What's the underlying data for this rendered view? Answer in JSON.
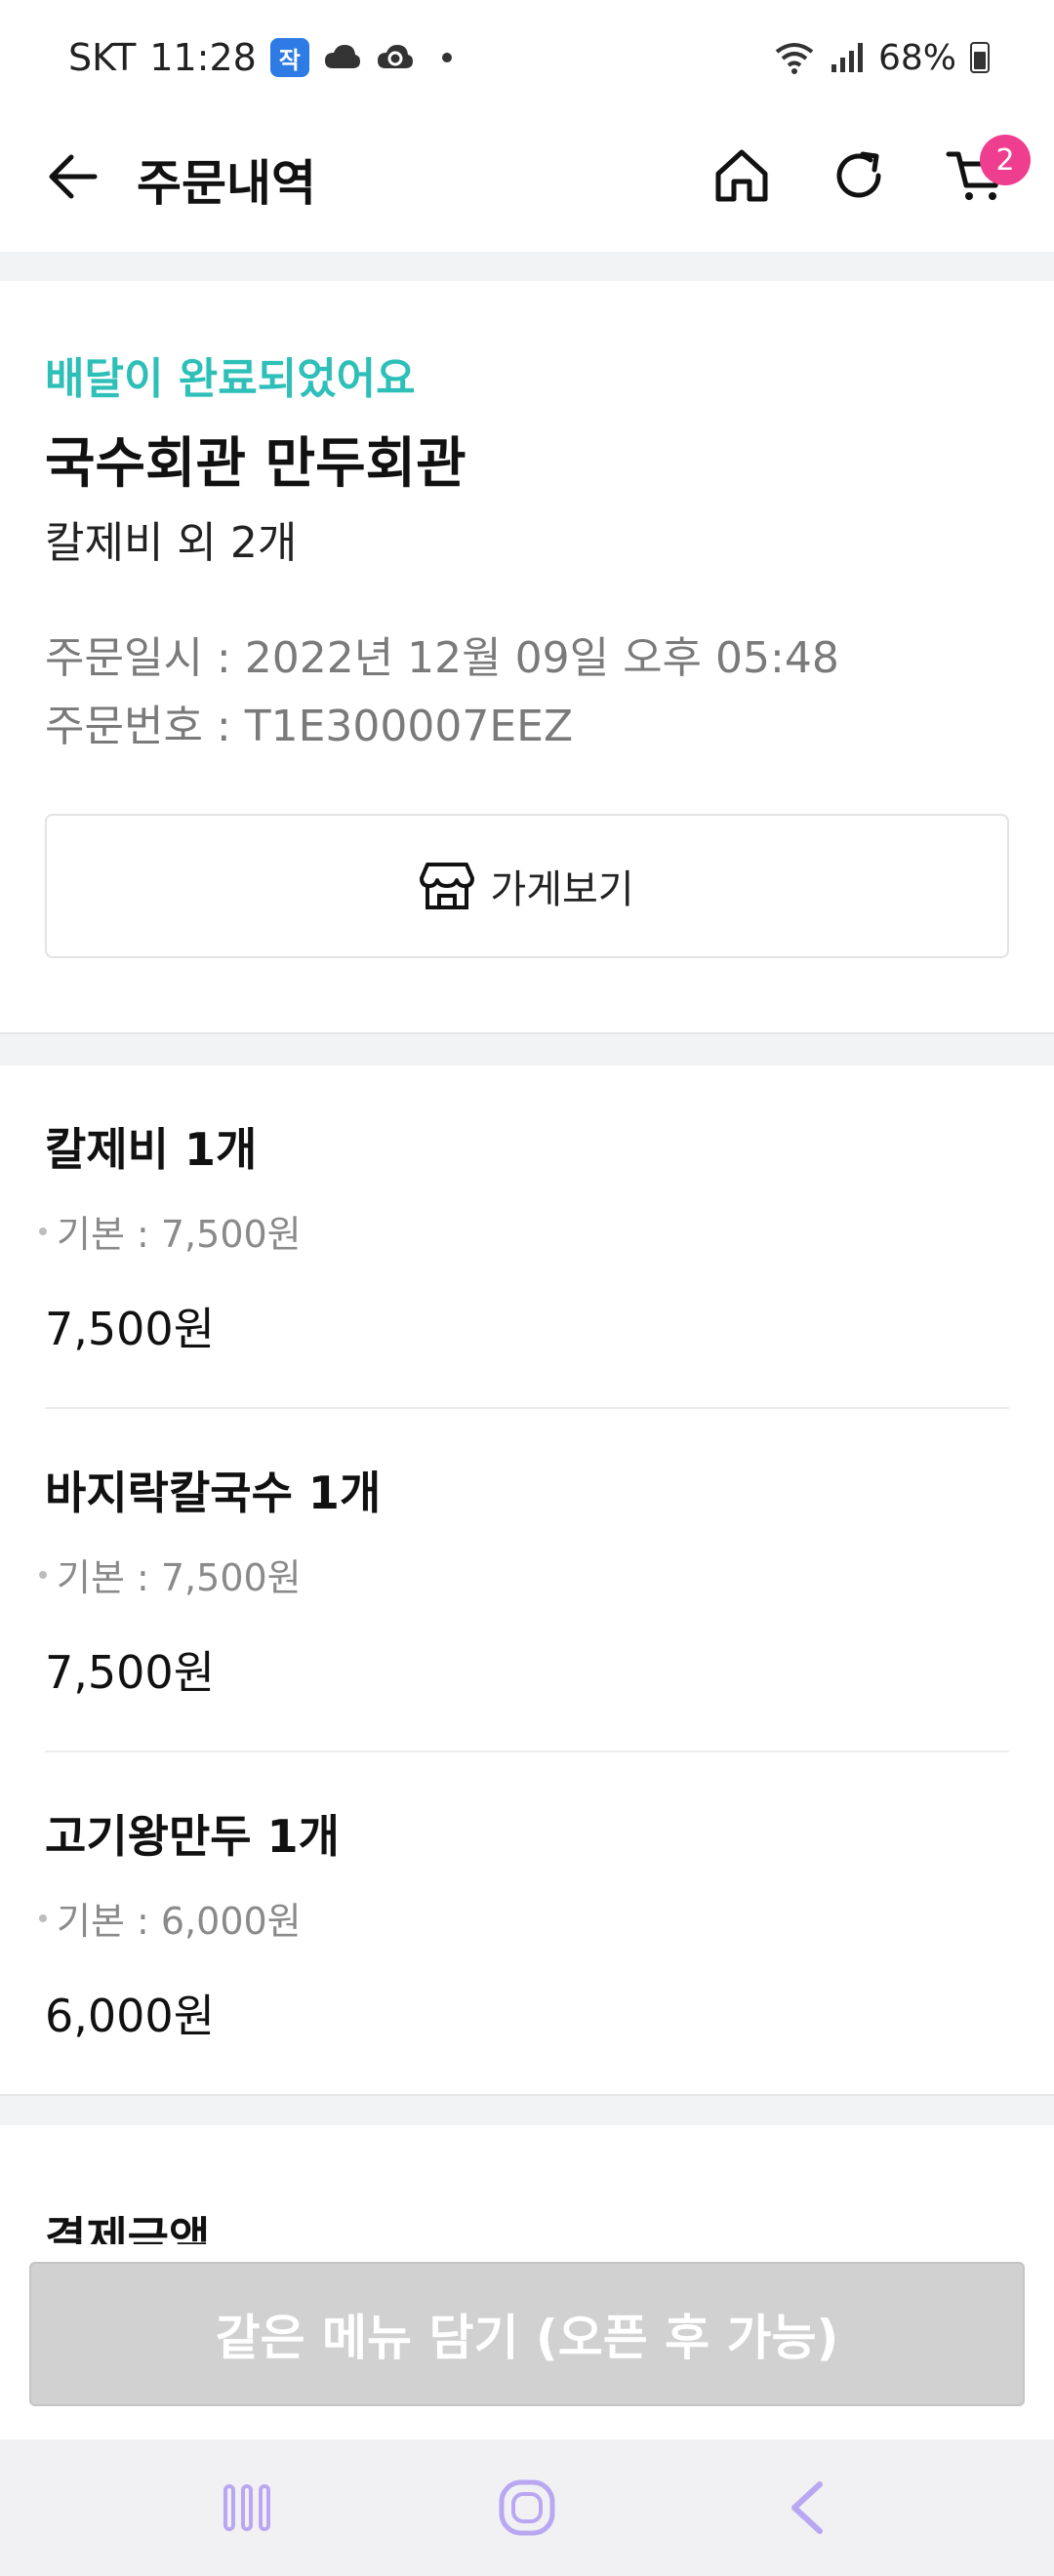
{
  "status_bar": {
    "carrier": "SKT",
    "time": "11:28",
    "badge": "작",
    "battery": "68%"
  },
  "app_bar": {
    "title": "주문내역",
    "cart_count": "2"
  },
  "order": {
    "status": "배달이 완료되었어요",
    "store_name": "국수회관 만두회관",
    "items_summary": "칼제비 외 2개",
    "date_line": "주문일시 : 2022년 12월 09일 오후 05:48",
    "number_line": "주문번호 : T1E300007EEZ",
    "store_button": "가게보기"
  },
  "items": [
    {
      "name": "칼제비 1개",
      "option": "기본 : 7,500원",
      "price": "7,500원"
    },
    {
      "name": "바지락칼국수 1개",
      "option": "기본 : 7,500원",
      "price": "7,500원"
    },
    {
      "name": "고기왕만두 1개",
      "option": "기본 : 6,000원",
      "price": "6,000원"
    }
  ],
  "payment": {
    "title": "결제금액"
  },
  "cta": {
    "label": "같은 메뉴 담기 (오픈 후 가능)"
  },
  "colors": {
    "accent_teal": "#2dbfb8",
    "badge_pink": "#ef3d8f",
    "cta_disabled": "#d1d1d1",
    "nav_icon": "#b9a7f2"
  },
  "icons": {
    "back": "back-arrow-icon",
    "home": "home-icon",
    "refresh": "refresh-icon",
    "cart": "cart-icon",
    "store": "store-icon",
    "nav_recent": "recent-apps-icon",
    "nav_home": "nav-home-icon",
    "nav_back": "nav-back-icon"
  }
}
